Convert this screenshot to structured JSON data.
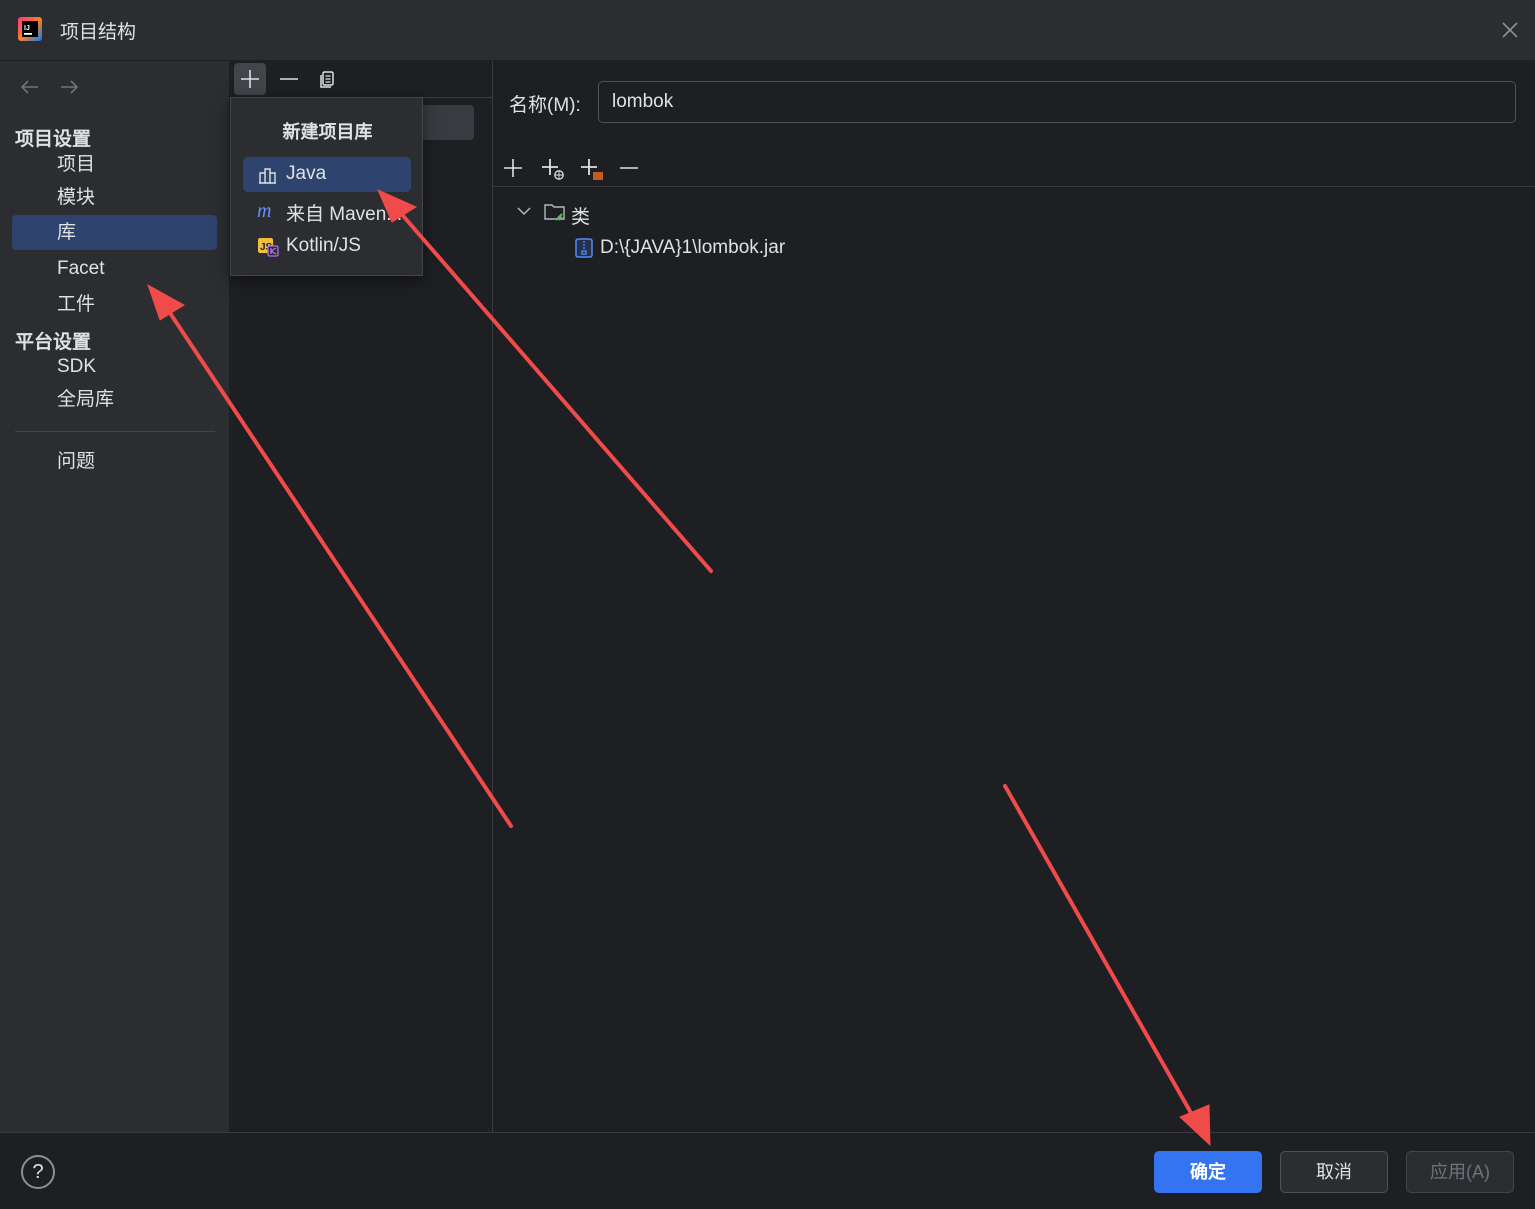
{
  "window": {
    "title": "项目结构"
  },
  "sidebar": {
    "project_settings_header": "项目设置",
    "project_items": [
      {
        "label": "项目"
      },
      {
        "label": "模块"
      },
      {
        "label": "库",
        "selected": true
      },
      {
        "label": "Facet"
      },
      {
        "label": "工件"
      }
    ],
    "platform_settings_header": "平台设置",
    "platform_items": [
      {
        "label": "SDK"
      },
      {
        "label": "全局库"
      }
    ],
    "problems_label": "问题"
  },
  "popup": {
    "title": "新建项目库",
    "items": [
      {
        "label": "Java",
        "icon": "library-icon",
        "selected": true
      },
      {
        "label": "来自 Maven...",
        "icon": "maven-icon"
      },
      {
        "label": "Kotlin/JS",
        "icon": "kotlin-js-icon"
      }
    ]
  },
  "detail": {
    "name_label": "名称(M):",
    "name_value": "lombok",
    "tree": {
      "root_label": "类",
      "children": [
        {
          "label": "D:\\{JAVA}1\\lombok.jar"
        }
      ]
    }
  },
  "footer": {
    "help_label": "?",
    "ok_label": "确定",
    "cancel_label": "取消",
    "apply_label": "应用(A)"
  },
  "colors": {
    "accent": "#3574f0",
    "selection": "#2e436e",
    "annotation_arrow": "#f04a4a"
  }
}
